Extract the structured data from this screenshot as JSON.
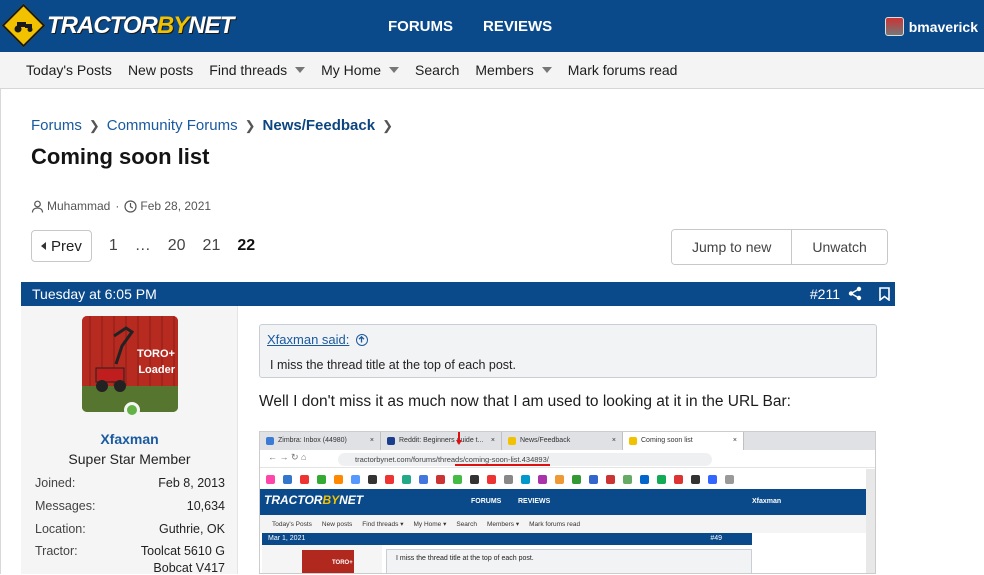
{
  "header": {
    "logo": {
      "prefix": "TRACTOR",
      "by": "BY",
      "suffix": "NET"
    },
    "nav": [
      "FORUMS",
      "REVIEWS"
    ],
    "username": "bmaverick"
  },
  "subnav": [
    {
      "label": "Today's Posts",
      "dropdown": false
    },
    {
      "label": "New posts",
      "dropdown": false
    },
    {
      "label": "Find threads",
      "dropdown": true
    },
    {
      "label": "My Home",
      "dropdown": true
    },
    {
      "label": "Search",
      "dropdown": false
    },
    {
      "label": "Members",
      "dropdown": true
    },
    {
      "label": "Mark forums read",
      "dropdown": false
    }
  ],
  "breadcrumb": [
    "Forums",
    "Community Forums",
    "News/Feedback"
  ],
  "thread": {
    "title": "Coming soon list",
    "author": "Muhammad",
    "date": "Feb 28, 2021"
  },
  "pager": {
    "prev": "Prev",
    "pages": [
      "1",
      "…",
      "20",
      "21",
      "22"
    ],
    "current": "22"
  },
  "actions": {
    "jump": "Jump to new",
    "unwatch": "Unwatch"
  },
  "post": {
    "time": "Tuesday at 6:05 PM",
    "number": "#211",
    "user": {
      "name": "Xfaxman",
      "title": "Super Star Member",
      "avatar_text": [
        "TORO+",
        "Loader"
      ],
      "stats": [
        {
          "key": "Joined:",
          "value": "Feb 8, 2013"
        },
        {
          "key": "Messages:",
          "value": "10,634"
        },
        {
          "key": "Location:",
          "value": "Guthrie, OK"
        },
        {
          "key": "Tractor:",
          "value": "Toolcat 5610 G"
        },
        {
          "key": "",
          "value": "Bobcat V417"
        }
      ]
    },
    "quote": {
      "author": "Xfaxman said:",
      "text": "I miss the thread title at the top of each post."
    },
    "body": "Well I don't miss it as much now that I am used to looking at it in the URL Bar:"
  },
  "screenshot": {
    "tabs": [
      "Zimbra: Inbox (44980)",
      "Reddit: Beginners guide t...",
      "News/Feedback",
      "Coming soon list"
    ],
    "url": "tractorbynet.com/forums/threads/coming-soon-list.434893/",
    "nav": [
      "FORUMS",
      "REVIEWS"
    ],
    "user": "Xfaxman",
    "subnav": [
      "Today's Posts",
      "New posts",
      "Find threads ▾",
      "My Home ▾",
      "Search",
      "Members ▾",
      "Mark forums read"
    ],
    "post_date": "Mar 1, 2021",
    "post_num": "#49",
    "quote": "I miss the thread title at the top of each post.",
    "avatar": "TORO+"
  },
  "colors": {
    "brand": "#0b4a8a",
    "link": "#1a5aa0",
    "logo_yellow": "#f2c200",
    "online": "#63b246"
  }
}
